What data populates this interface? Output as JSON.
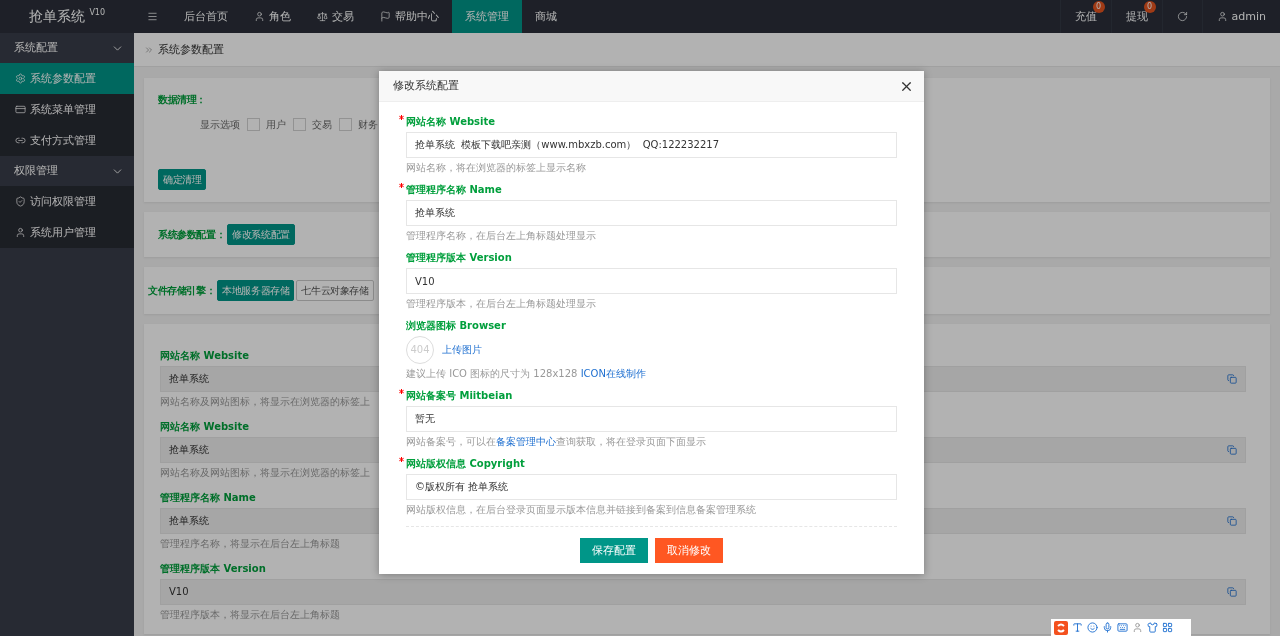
{
  "logo": "抢单系统 $^{V10}$",
  "top_nav": [
    {
      "label": "后台首页",
      "selected": false
    },
    {
      "label": "角色",
      "selected": false
    },
    {
      "label": "交易",
      "selected": false
    },
    {
      "label": "帮助中心",
      "selected": false
    },
    {
      "label": "系统管理",
      "selected": true
    },
    {
      "label": "商城",
      "selected": false
    }
  ],
  "top_right": {
    "items": [
      {
        "label": "充值",
        "badge": "0"
      },
      {
        "label": "提现",
        "badge": "0"
      }
    ],
    "user": "admin"
  },
  "sidebar": [
    {
      "label": "系统配置",
      "expanded": true,
      "children": [
        {
          "label": "系统参数配置",
          "selected": true
        },
        {
          "label": "系统菜单管理",
          "selected": false
        },
        {
          "label": "支付方式管理",
          "selected": false
        }
      ]
    },
    {
      "label": "权限管理",
      "expanded": true,
      "children": [
        {
          "label": "访问权限管理",
          "selected": false
        },
        {
          "label": "系统用户管理",
          "selected": false
        }
      ]
    }
  ],
  "breadcrumb": "系统参数配置",
  "clean_card": {
    "title": "数据清理：",
    "options_label": "显示选项",
    "options": [
      {
        "label": "用户",
        "checked": false
      },
      {
        "label": "交易",
        "checked": false
      },
      {
        "label": "财务",
        "checked": false
      }
    ],
    "button": "确定清理"
  },
  "config_card": {
    "title": "系统参数配置：",
    "button": "修改系统配置"
  },
  "storage_card": {
    "title": "文件存储引擎：",
    "options": [
      {
        "label": "本地服务器存储",
        "selected": true
      },
      {
        "label": "七牛云对象存储",
        "selected": false
      }
    ]
  },
  "settings": [
    {
      "label": "网站名称 Website",
      "value": "抢单系统",
      "help": "网站名称及网站图标，将显示在浏览器的标签上"
    },
    {
      "label": "网站名称 Website",
      "value": "抢单系统",
      "help": "网站名称及网站图标，将显示在浏览器的标签上"
    },
    {
      "label": "管理程序名称 Name",
      "value": "抢单系统",
      "help": "管理程序名称，将显示在后台左上角标题"
    },
    {
      "label": "管理程序版本 Version",
      "value": "V10",
      "help": "管理程序版本，将显示在后台左上角标题"
    }
  ],
  "modal": {
    "title": "修改系统配置",
    "fields": [
      {
        "kind": "text",
        "required": true,
        "label": "网站名称 Website",
        "value": "抢单系统  模板下载吧亲测（www.mbxzb.com）  QQ:122232217",
        "help": "网站名称，将在浏览器的标签上显示名称"
      },
      {
        "kind": "text",
        "required": true,
        "label": "管理程序名称 Name",
        "value": "抢单系统",
        "help": "管理程序名称，在后台左上角标题处理显示"
      },
      {
        "kind": "text",
        "required": false,
        "label": "管理程序版本 Version",
        "value": "V10",
        "help": "管理程序版本，在后台左上角标题处理显示"
      },
      {
        "kind": "image",
        "required": false,
        "label": "浏览器图标 Browser",
        "placeholder_image": "404",
        "upload": "上传图片",
        "help": "建议上传 ICO 图标的尺寸为 128x128",
        "help_link": "ICON在线制作"
      },
      {
        "kind": "text",
        "required": true,
        "label": "网站备案号 Miitbeian",
        "value": "暂无",
        "help": "网站备案号，可以在",
        "help_link": "备案管理中心",
        "help_after": "查询获取，将在登录页面下面显示"
      },
      {
        "kind": "text",
        "required": true,
        "label": "网站版权信息 Copyright",
        "value": "©版权所有 抢单系统",
        "help": "网站版权信息，在后台登录页面显示版本信息并链接到备案到信息备案管理系统"
      }
    ],
    "buttons": [
      {
        "label": "保存配置",
        "kind": "primary"
      },
      {
        "label": "取消修改",
        "kind": "danger"
      }
    ]
  }
}
